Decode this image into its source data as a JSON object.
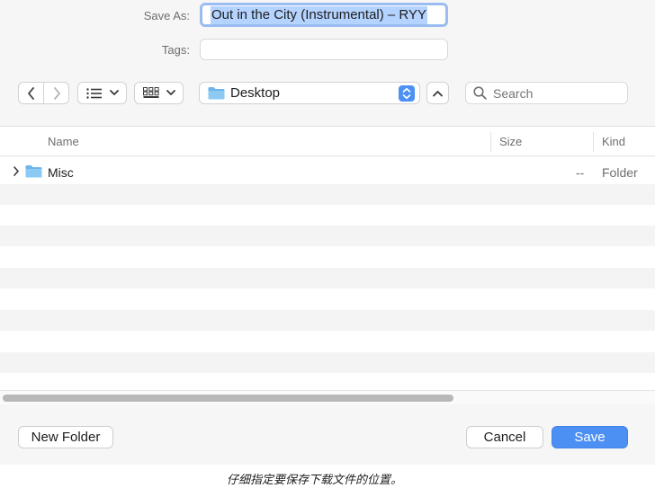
{
  "form": {
    "save_as_label": "Save As:",
    "save_as_value": "Out in the City (Instrumental) – RYY",
    "tags_label": "Tags:",
    "tags_value": ""
  },
  "toolbar": {
    "location": "Desktop",
    "search_placeholder": "Search"
  },
  "table": {
    "columns": [
      "Name",
      "Size",
      "Kind"
    ],
    "rows": [
      {
        "name": "Misc",
        "size": "--",
        "kind": "Folder"
      }
    ]
  },
  "buttons": {
    "new_folder": "New Folder",
    "cancel": "Cancel",
    "save": "Save"
  },
  "caption": "仔细指定要保存下载文件的位置。",
  "colors": {
    "accent": "#4d90f4",
    "selection": "#b5d3ff",
    "folder": "#6cb4ea"
  }
}
